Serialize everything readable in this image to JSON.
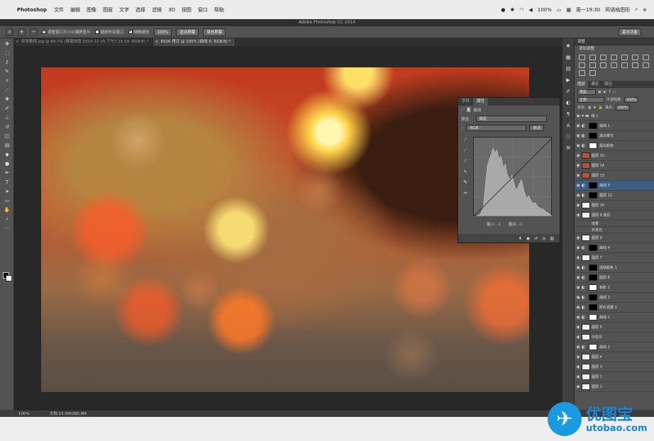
{
  "menubar": {
    "app": "Photoshop",
    "items": [
      "文件",
      "编辑",
      "图像",
      "图层",
      "文字",
      "选择",
      "滤镜",
      "3D",
      "视图",
      "窗口",
      "帮助"
    ],
    "battery": "100%",
    "clock": "周一19:30",
    "user": "阿诺格图形"
  },
  "window_title": "Adobe Photoshop CC 2014",
  "options": {
    "resize_windows": "调整窗口大小以满屏显示",
    "zoom_all": "缩放所有窗口",
    "scrubby": "细微缩放",
    "zoom_100": "100%",
    "fit_screen": "适合屏幕",
    "fill_screen": "填充屏幕",
    "workspace": "基本功能"
  },
  "tabs": [
    {
      "label": "带添教程.jpg @ 69.7% (屏幕快照 2014-12-15 下午7.15.59, RGB/8) *",
      "active": false
    },
    {
      "label": "6026 拷贝 @ 100% (曲线 6, RGB/8) *",
      "active": true
    }
  ],
  "properties": {
    "tab_chars": "字符",
    "tab_props": "属性",
    "type_label": "曲线",
    "preset_label": "预设：",
    "preset_value": "自定",
    "channel_value": "RGB",
    "auto_button": "自动",
    "input_label": "输入: -1",
    "output_label": "输出: -1"
  },
  "adjust_panel": {
    "header": "调整",
    "title": "添加调整"
  },
  "layers_panel": {
    "tabs": [
      "图层",
      "通道",
      "路径"
    ],
    "kind_label": "类型",
    "blend_mode": "正常",
    "opacity_label": "不透明度:",
    "opacity_value": "100%",
    "lock_label": "锁定:",
    "fill_label": "填充:",
    "fill_value": "100%",
    "layers": [
      {
        "name": "组 1",
        "kind": "group"
      },
      {
        "name": "曲线 1",
        "kind": "adjust"
      },
      {
        "name": "黑白柔光",
        "kind": "adjust"
      },
      {
        "name": "黑白颜色",
        "kind": "adjust"
      },
      {
        "name": "图层 15",
        "kind": "pixel"
      },
      {
        "name": "图层 14",
        "kind": "pixel"
      },
      {
        "name": "图层 13",
        "kind": "pixel"
      },
      {
        "name": "曲线 5",
        "kind": "adjust"
      },
      {
        "name": "图层 12",
        "kind": "adjust"
      },
      {
        "name": "图层 10",
        "kind": "pixel"
      },
      {
        "name": "图层 8 拷贝",
        "kind": "pixel"
      },
      {
        "name": "效果",
        "kind": "fx"
      },
      {
        "name": "外发光",
        "kind": "fx"
      },
      {
        "name": "图层 9",
        "kind": "pixel"
      },
      {
        "name": "曲线 4",
        "kind": "adjust"
      },
      {
        "name": "图层 7",
        "kind": "pixel"
      },
      {
        "name": "选取颜色 1",
        "kind": "adjust"
      },
      {
        "name": "图层 6",
        "kind": "adjust"
      },
      {
        "name": "色阶 1",
        "kind": "adjust"
      },
      {
        "name": "曲线 3",
        "kind": "adjust"
      },
      {
        "name": "照片滤镜 1",
        "kind": "adjust"
      },
      {
        "name": "曲线 2",
        "kind": "adjust"
      },
      {
        "name": "图层 5",
        "kind": "pixel"
      },
      {
        "name": "中性灰",
        "kind": "pixel"
      },
      {
        "name": "曲线 2",
        "kind": "adjust"
      },
      {
        "name": "图层 4",
        "kind": "pixel"
      },
      {
        "name": "图层 3",
        "kind": "pixel"
      },
      {
        "name": "图层 2",
        "kind": "pixel"
      },
      {
        "name": "图层 1",
        "kind": "pixel"
      }
    ]
  },
  "status": {
    "zoom": "100%",
    "doc_size": "文档:15.5M/285.8M"
  },
  "watermark": {
    "cn": "优图宝",
    "en": "utobao.com"
  },
  "colors": {
    "selection": "#3e5d80",
    "panel_bg": "#535353",
    "logo_blue": "#1a9be0"
  }
}
